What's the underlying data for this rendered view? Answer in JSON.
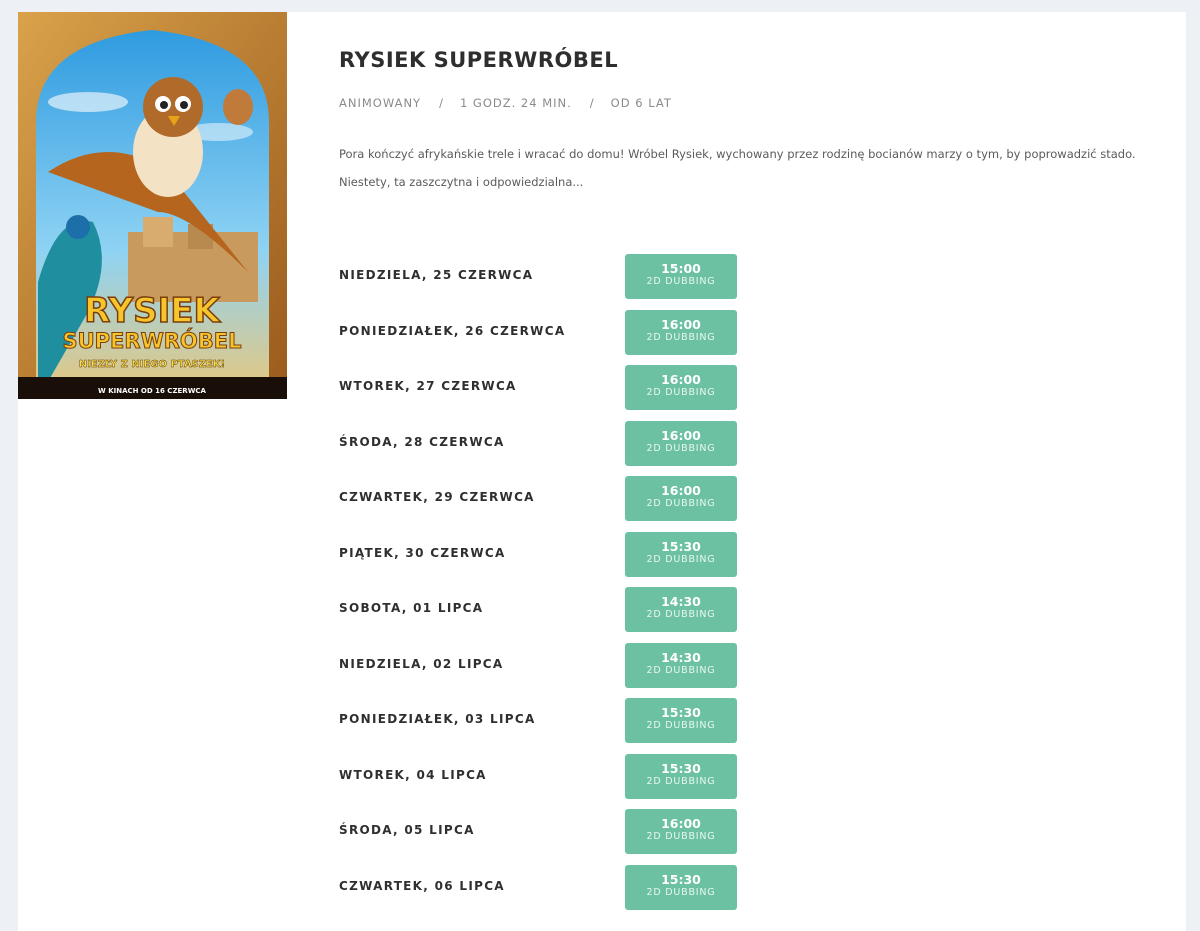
{
  "movie": {
    "title": "RYSIEK SUPERWRÓBEL",
    "genre": "ANIMOWANY",
    "separator": "/",
    "duration": "1 GODZ. 24 MIN.",
    "age": "OD 6 LAT",
    "synopsis": "Pora kończyć afrykańskie trele i wracać do domu! Wróbel Rysiek, wychowany przez rodzinę bocianów marzy o tym, by poprowadzić stado. Niestety, ta zaszczytna i odpowiedzialna...",
    "poster": {
      "title_line1": "RYSIEK",
      "title_line2": "SUPERWRÓBEL",
      "tagline": "NIEZŁY Z NIEGO PTASZEK!",
      "footer": "W KINACH OD 16 CZERWCA"
    }
  },
  "showtimes": [
    {
      "day": "NIEDZIELA, 25 CZERWCA",
      "time": "15:00",
      "version": "2D DUBBING"
    },
    {
      "day": "PONIEDZIAŁEK, 26 CZERWCA",
      "time": "16:00",
      "version": "2D DUBBING"
    },
    {
      "day": "WTOREK, 27 CZERWCA",
      "time": "16:00",
      "version": "2D DUBBING"
    },
    {
      "day": "ŚRODA, 28 CZERWCA",
      "time": "16:00",
      "version": "2D DUBBING"
    },
    {
      "day": "CZWARTEK, 29 CZERWCA",
      "time": "16:00",
      "version": "2D DUBBING"
    },
    {
      "day": "PIĄTEK, 30 CZERWCA",
      "time": "15:30",
      "version": "2D DUBBING"
    },
    {
      "day": "SOBOTA, 01 LIPCA",
      "time": "14:30",
      "version": "2D DUBBING"
    },
    {
      "day": "NIEDZIELA, 02 LIPCA",
      "time": "14:30",
      "version": "2D DUBBING"
    },
    {
      "day": "PONIEDZIAŁEK, 03 LIPCA",
      "time": "15:30",
      "version": "2D DUBBING"
    },
    {
      "day": "WTOREK, 04 LIPCA",
      "time": "15:30",
      "version": "2D DUBBING"
    },
    {
      "day": "ŚRODA, 05 LIPCA",
      "time": "16:00",
      "version": "2D DUBBING"
    },
    {
      "day": "CZWARTEK, 06 LIPCA",
      "time": "15:30",
      "version": "2D DUBBING"
    }
  ],
  "colors": {
    "page_bg": "#edf1f6",
    "card_bg": "#ffffff",
    "button_bg": "#6cc1a3",
    "button_text": "#ffffff"
  }
}
